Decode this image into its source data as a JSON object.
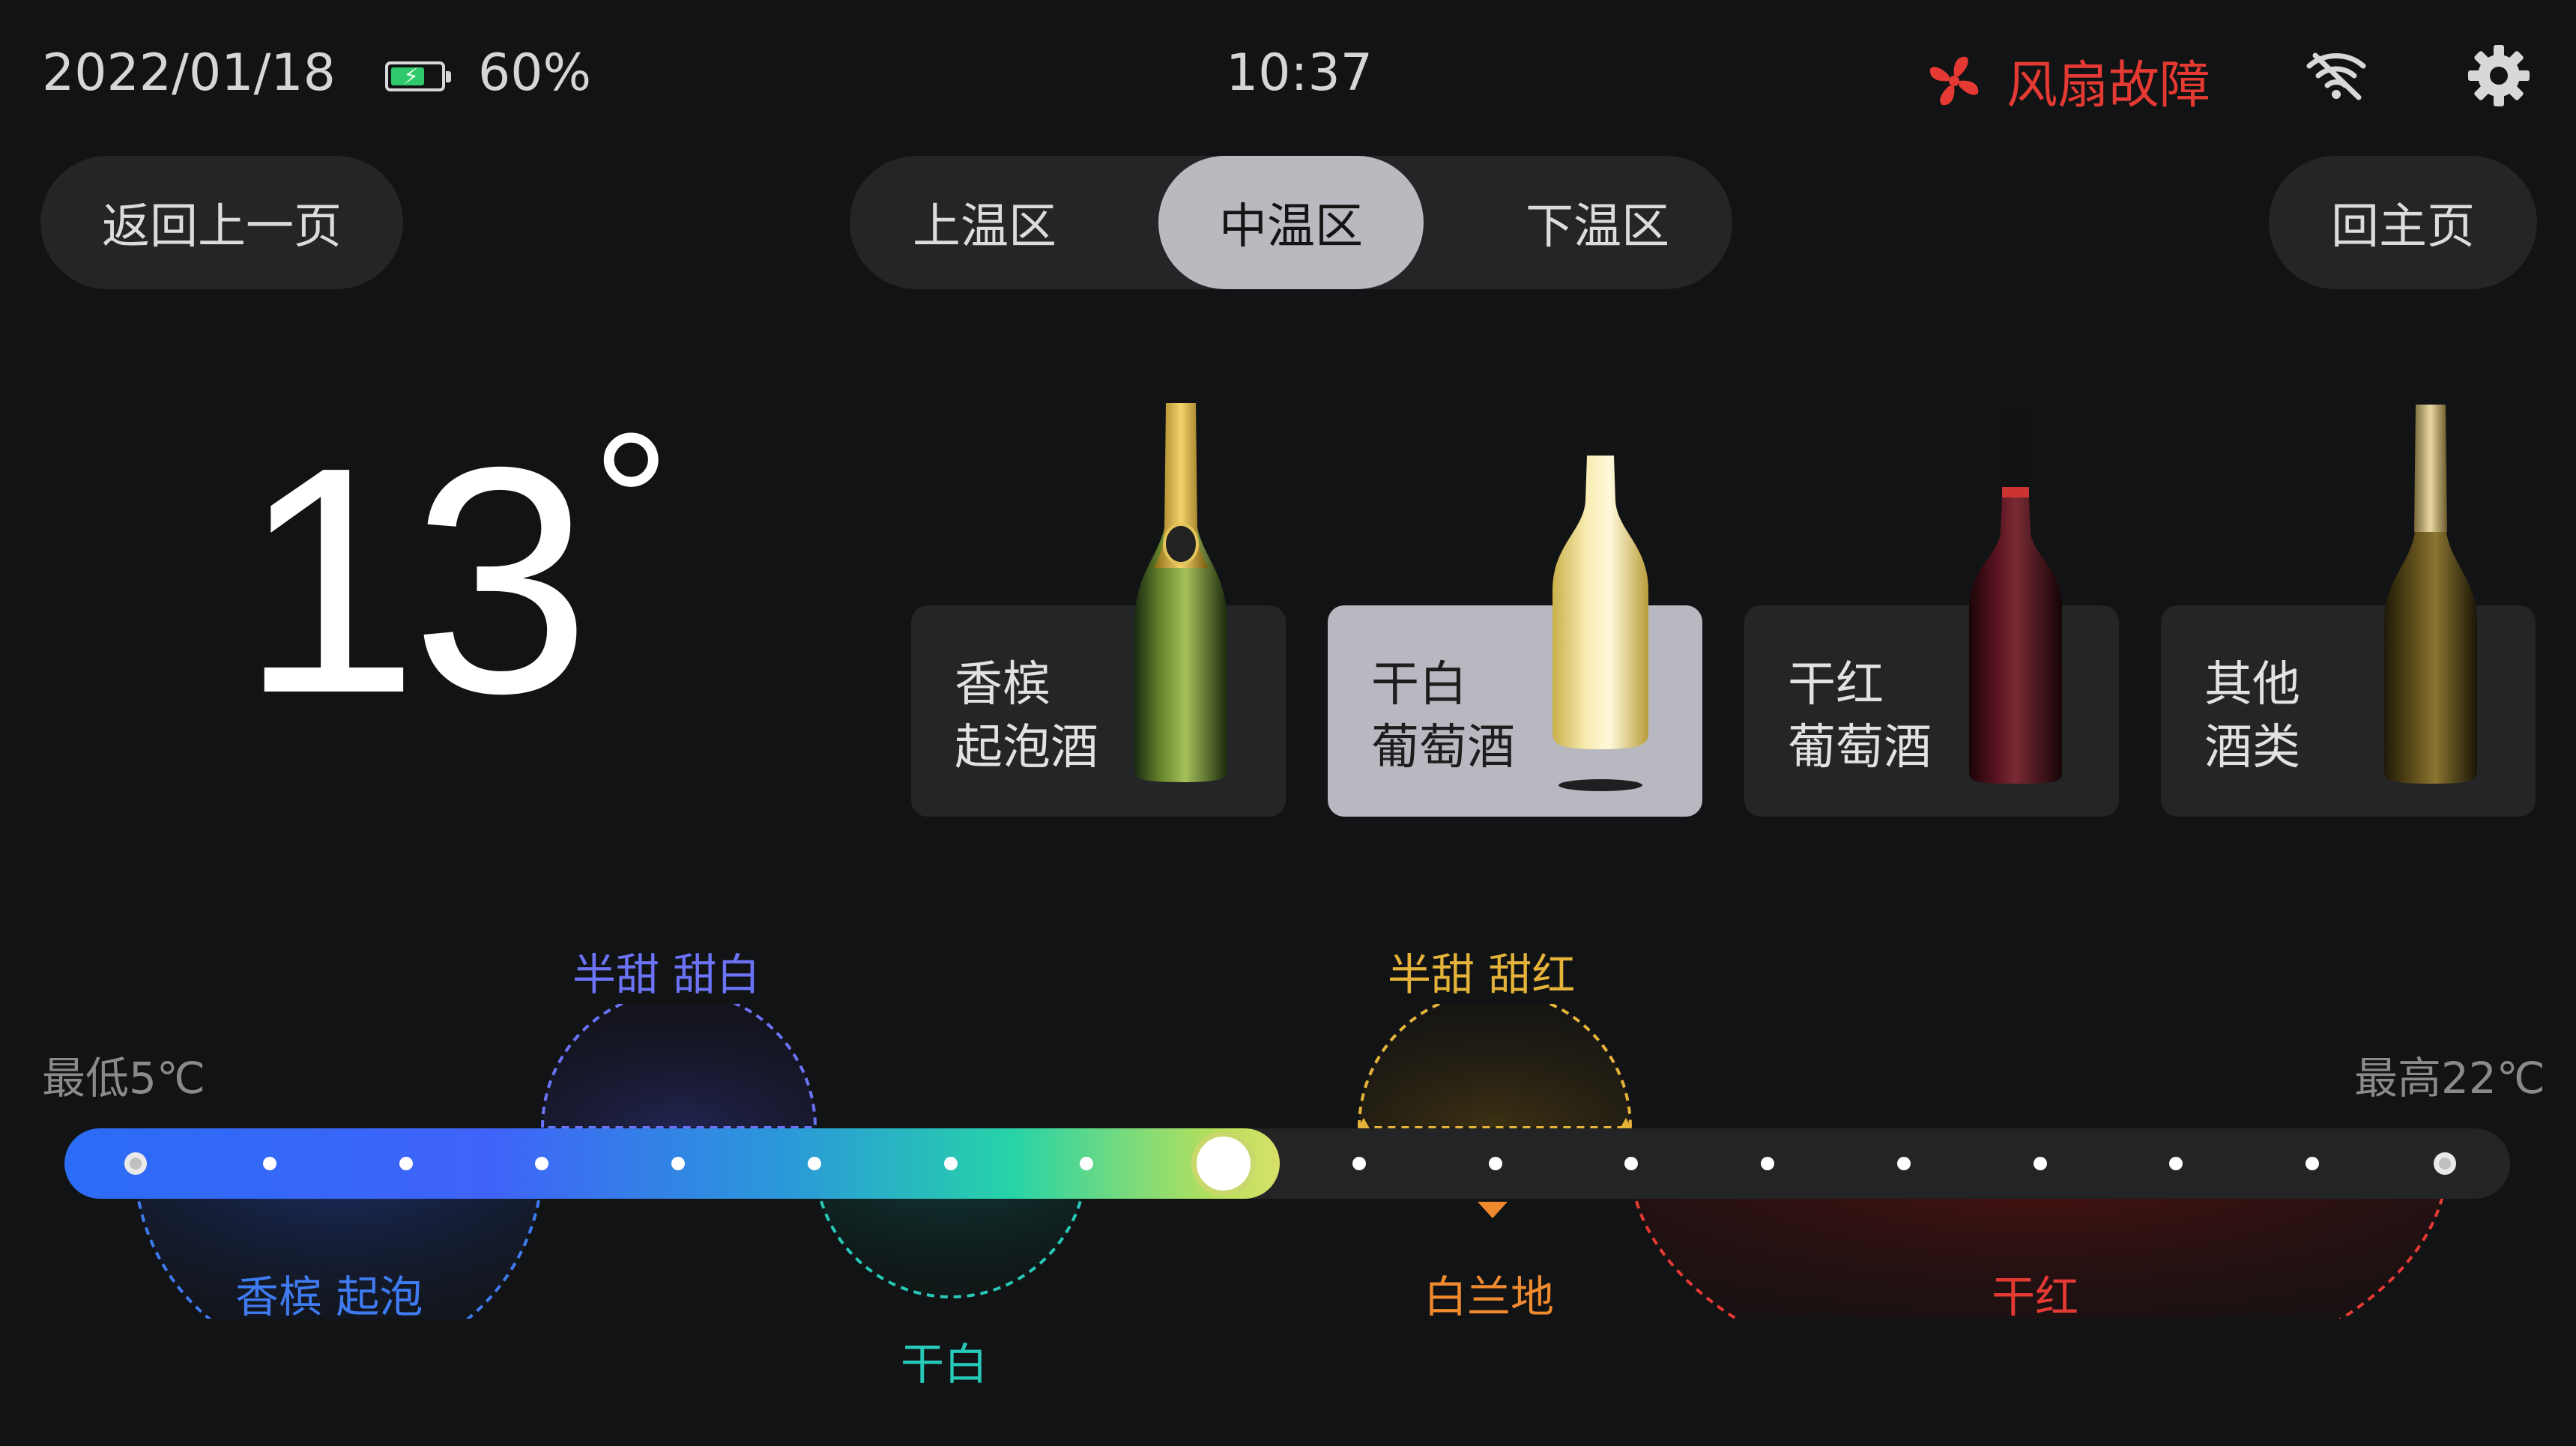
{
  "status": {
    "date": "2022/01/18",
    "battery_percent": "60%",
    "battery_level": 0.6,
    "time": "10:37",
    "alert_text": "风扇故障",
    "alert_color": "#e53a33",
    "wifi_icon": "wifi-off-icon",
    "settings_icon": "gear-icon"
  },
  "nav": {
    "back_label": "返回上一页",
    "home_label": "回主页",
    "zones": [
      {
        "label": "上温区",
        "active": false
      },
      {
        "label": "中温区",
        "active": true
      },
      {
        "label": "下温区",
        "active": false
      }
    ]
  },
  "temperature": {
    "value": "13",
    "unit": "°"
  },
  "wine_types": [
    {
      "line1": "香槟",
      "line2": "起泡酒",
      "active": false,
      "bottle_icon": "champagne-bottle-icon"
    },
    {
      "line1": "干白",
      "line2": "葡萄酒",
      "active": true,
      "bottle_icon": "white-wine-bottle-icon"
    },
    {
      "line1": "干红",
      "line2": "葡萄酒",
      "active": false,
      "bottle_icon": "red-wine-bottle-icon"
    },
    {
      "line1": "其他",
      "line2": "酒类",
      "active": false,
      "bottle_icon": "other-wine-bottle-icon"
    }
  ],
  "scale": {
    "min_label": "最低5℃",
    "max_label": "最高22℃",
    "min_value": 5,
    "max_value": 22,
    "current_value": 13,
    "ranges": [
      {
        "label": "香槟 起泡",
        "color": "#3f7bf0"
      },
      {
        "label": "半甜 甜白",
        "color": "#6b73f6"
      },
      {
        "label": "干白",
        "color": "#27c9b8"
      },
      {
        "label": "半甜 甜红",
        "color": "#e6b33a"
      },
      {
        "label": "白兰地",
        "color": "#f08a2e"
      },
      {
        "label": "干红",
        "color": "#e53a33"
      }
    ]
  }
}
